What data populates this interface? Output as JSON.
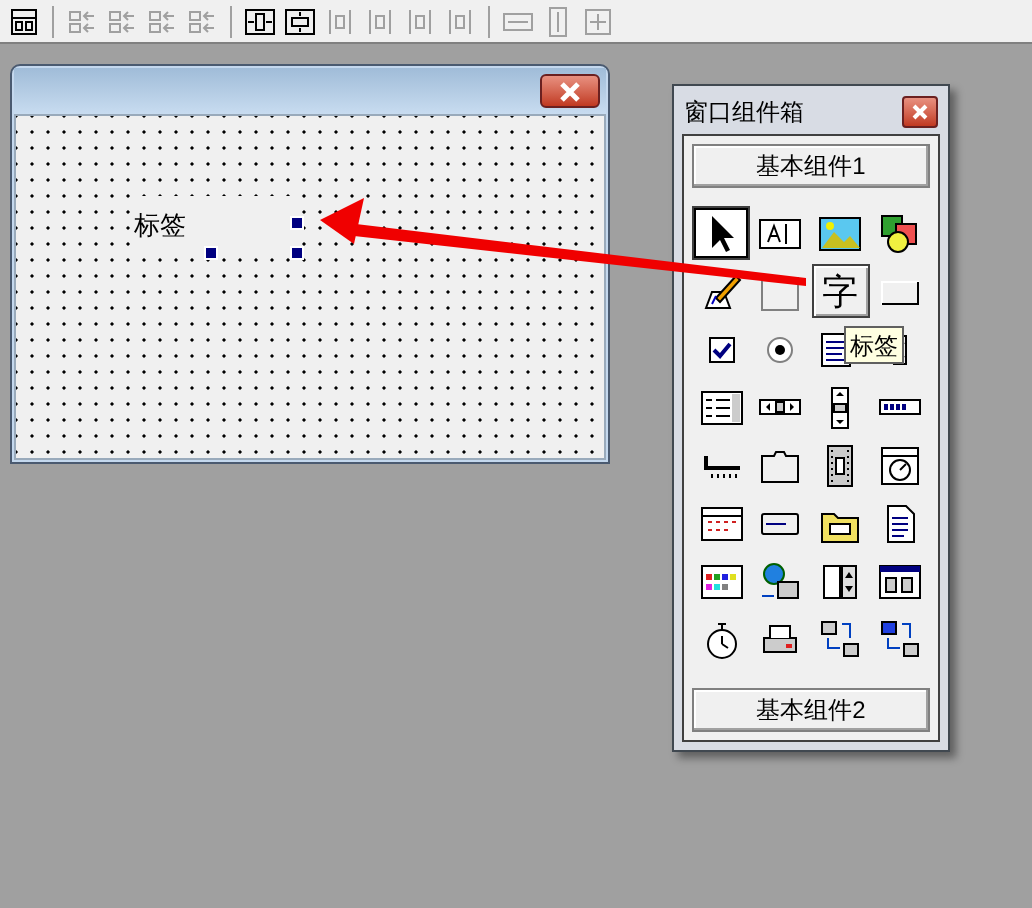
{
  "toolbar": [
    {
      "kind": "layout",
      "disabled": false
    },
    {
      "kind": "sep"
    },
    {
      "kind": "align-left",
      "disabled": true
    },
    {
      "kind": "align-right",
      "disabled": true
    },
    {
      "kind": "align-top",
      "disabled": true
    },
    {
      "kind": "align-bottom",
      "disabled": true
    },
    {
      "kind": "sep"
    },
    {
      "kind": "center-h",
      "disabled": false
    },
    {
      "kind": "center-v",
      "disabled": false
    },
    {
      "kind": "align-middle",
      "disabled": true
    },
    {
      "kind": "align-center",
      "disabled": true
    },
    {
      "kind": "space-h",
      "disabled": true
    },
    {
      "kind": "space-v",
      "disabled": true
    },
    {
      "kind": "sep"
    },
    {
      "kind": "same-width",
      "disabled": true
    },
    {
      "kind": "same-height",
      "disabled": true
    },
    {
      "kind": "same-size",
      "disabled": true
    }
  ],
  "form": {
    "label": {
      "text": "标签",
      "selected": true
    }
  },
  "toolbox": {
    "title": "窗口组件箱",
    "groups": [
      {
        "label": "基本组件1"
      },
      {
        "label": "基本组件2"
      }
    ],
    "tools": [
      {
        "kind": "pointer",
        "selected": true,
        "hovered": false
      },
      {
        "kind": "textbox",
        "selected": false,
        "hovered": false
      },
      {
        "kind": "picture",
        "selected": false,
        "hovered": false
      },
      {
        "kind": "shapes",
        "selected": false,
        "hovered": false
      },
      {
        "kind": "pen",
        "selected": false,
        "hovered": false
      },
      {
        "kind": "frame",
        "selected": false,
        "hovered": false
      },
      {
        "kind": "label",
        "glyph": "字",
        "selected": false,
        "hovered": true
      },
      {
        "kind": "button",
        "selected": false,
        "hovered": false
      },
      {
        "kind": "checkbox",
        "selected": false,
        "hovered": false
      },
      {
        "kind": "radio",
        "selected": false,
        "hovered": false
      },
      {
        "kind": "listbox",
        "selected": false,
        "hovered": false
      },
      {
        "kind": "combobox",
        "selected": false,
        "hovered": false
      },
      {
        "kind": "checklist",
        "selected": false,
        "hovered": false
      },
      {
        "kind": "hscroll",
        "selected": false,
        "hovered": false
      },
      {
        "kind": "vscroll",
        "selected": false,
        "hovered": false
      },
      {
        "kind": "progress",
        "selected": false,
        "hovered": false
      },
      {
        "kind": "slider",
        "selected": false,
        "hovered": false
      },
      {
        "kind": "tabs",
        "selected": false,
        "hovered": false
      },
      {
        "kind": "film",
        "selected": false,
        "hovered": false
      },
      {
        "kind": "dial",
        "selected": false,
        "hovered": false
      },
      {
        "kind": "calendar",
        "selected": false,
        "hovered": false
      },
      {
        "kind": "statusbar",
        "selected": false,
        "hovered": false
      },
      {
        "kind": "folder",
        "selected": false,
        "hovered": false
      },
      {
        "kind": "document",
        "selected": false,
        "hovered": false
      },
      {
        "kind": "palette",
        "selected": false,
        "hovered": false
      },
      {
        "kind": "network",
        "selected": false,
        "hovered": false
      },
      {
        "kind": "spinner",
        "selected": false,
        "hovered": false
      },
      {
        "kind": "window",
        "selected": false,
        "hovered": false
      },
      {
        "kind": "stopwatch",
        "selected": false,
        "hovered": false
      },
      {
        "kind": "printer",
        "selected": false,
        "hovered": false
      },
      {
        "kind": "transfer",
        "selected": false,
        "hovered": false
      },
      {
        "kind": "transfer2",
        "selected": false,
        "hovered": false
      }
    ],
    "tooltip": {
      "text": "标签"
    }
  }
}
